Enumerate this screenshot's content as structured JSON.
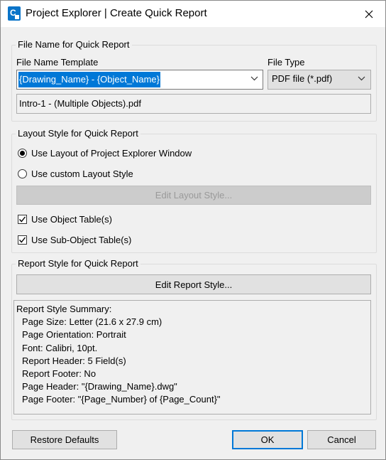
{
  "window": {
    "title": "Project Explorer | Create Quick Report"
  },
  "file_name_group": {
    "legend": "File Name for Quick Report",
    "template_label": "File Name Template",
    "template_value": "{Drawing_Name} - {Object_Name}",
    "file_type_label": "File Type",
    "file_type_value": "PDF file (*.pdf)",
    "preview": "Intro-1 - (Multiple Objects).pdf"
  },
  "layout_group": {
    "legend": "Layout Style for Quick Report",
    "radio_project_explorer": "Use Layout of Project Explorer Window",
    "radio_project_explorer_selected": true,
    "radio_custom": "Use custom Layout Style",
    "edit_layout_button": "Edit Layout Style...",
    "checkbox_object_table": "Use Object Table(s)",
    "checkbox_object_table_checked": true,
    "checkbox_subobject_table": "Use Sub-Object Table(s)",
    "checkbox_subobject_table_checked": true
  },
  "report_group": {
    "legend": "Report Style for Quick Report",
    "edit_report_button": "Edit Report Style...",
    "summary_title": "Report Style Summary:",
    "summary_lines": [
      "Page Size: Letter (21.6 x 27.9 cm)",
      "Page Orientation: Portrait",
      "Font: Calibri, 10pt.",
      "Report Header: 5 Field(s)",
      "Report Footer: No",
      "Page Header: \"{Drawing_Name}.dwg\"",
      "Page Footer: \"{Page_Number} of {Page_Count}\""
    ]
  },
  "footer": {
    "restore_defaults": "Restore Defaults",
    "ok": "OK",
    "cancel": "Cancel"
  },
  "colors": {
    "selection": "#0078d7",
    "dialog_bg": "#f0f0f0",
    "app_icon": "#0a74c9"
  }
}
